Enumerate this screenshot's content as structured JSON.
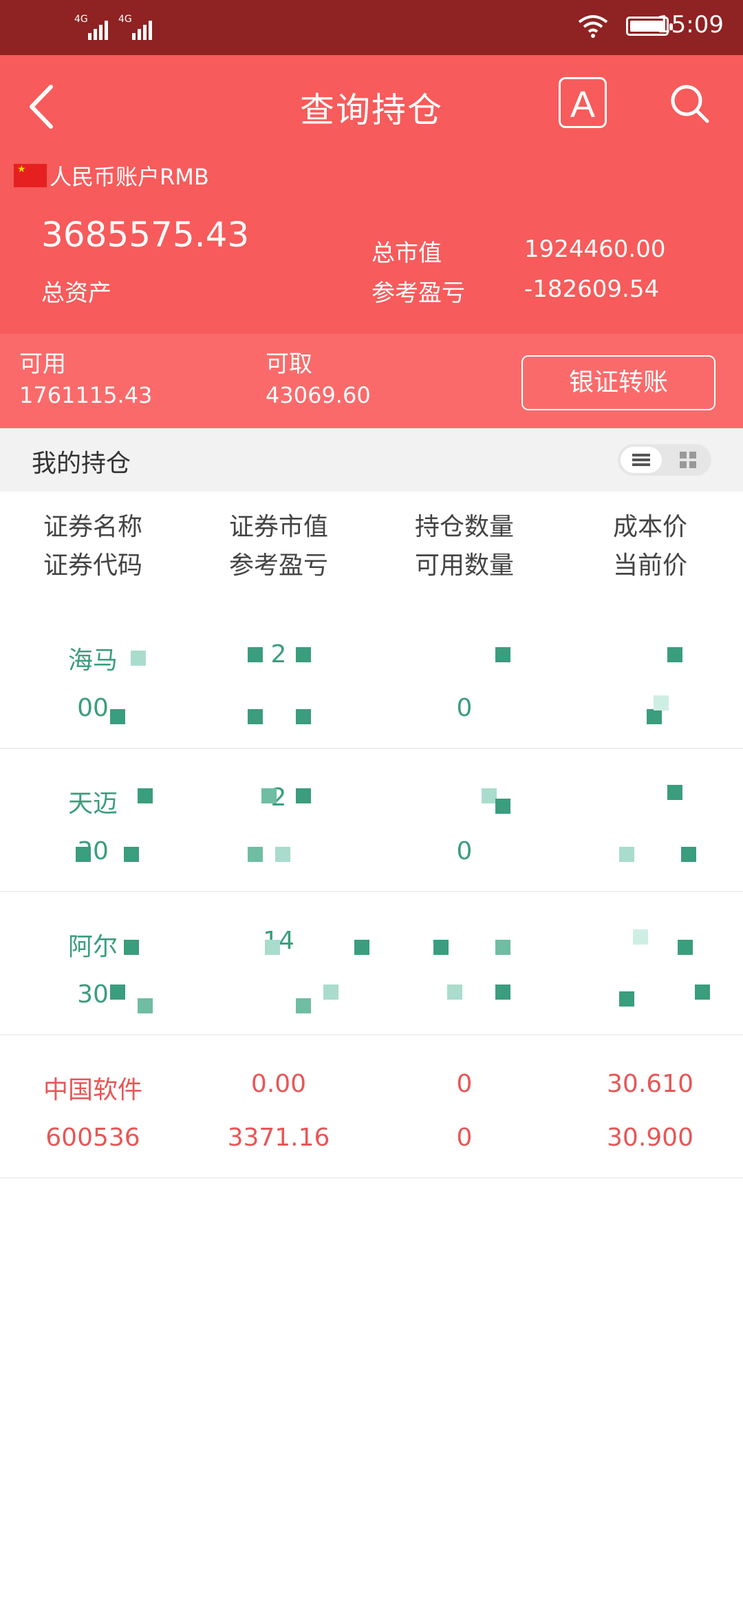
{
  "status_bar": {
    "network1": "4G",
    "network2": "4G",
    "time": "15:09"
  },
  "header": {
    "title": "查询持仓",
    "font_button": "A",
    "account": "人民币账户RMB",
    "total_assets_value": "3685575.43",
    "total_assets_label": "总资产",
    "market_value_label": "总市值",
    "market_value": "1924460.00",
    "pnl_label": "参考盈亏",
    "pnl_value": "-182609.54"
  },
  "funds": {
    "available_label": "可用",
    "available_value": "1761115.43",
    "withdrawable_label": "可取",
    "withdrawable_value": "43069.60",
    "transfer_button": "银证转账"
  },
  "holdings": {
    "section_title": "我的持仓",
    "columns": [
      {
        "line1": "证券名称",
        "line2": "证券代码"
      },
      {
        "line1": "证券市值",
        "line2": "参考盈亏"
      },
      {
        "line1": "持仓数量",
        "line2": "可用数量"
      },
      {
        "line1": "成本价",
        "line2": "当前价"
      }
    ],
    "rows": [
      {
        "name": "海马",
        "code": "00",
        "market_value": "2",
        "pnl": "",
        "qty": "",
        "avail": "0",
        "cost": "",
        "price": ""
      },
      {
        "name": "天迈",
        "code": "30",
        "market_value": "2",
        "pnl": "",
        "qty": "",
        "avail": "0",
        "cost": "",
        "price": ""
      },
      {
        "name": "阿尔",
        "code": "30",
        "market_value": "14",
        "pnl": "",
        "qty": "",
        "avail": "",
        "cost": "",
        "price": ""
      },
      {
        "name": "中国软件",
        "code": "600536",
        "market_value": "0.00",
        "pnl": "3371.16",
        "qty": "0",
        "avail": "0",
        "cost": "30.610",
        "price": "30.900"
      }
    ]
  },
  "colors": {
    "status_bar": "#8f2222",
    "header": "#f75b5b",
    "sub_band": "#fb6a6a",
    "gain": "#3a9d7e",
    "loss": "#e85656"
  }
}
